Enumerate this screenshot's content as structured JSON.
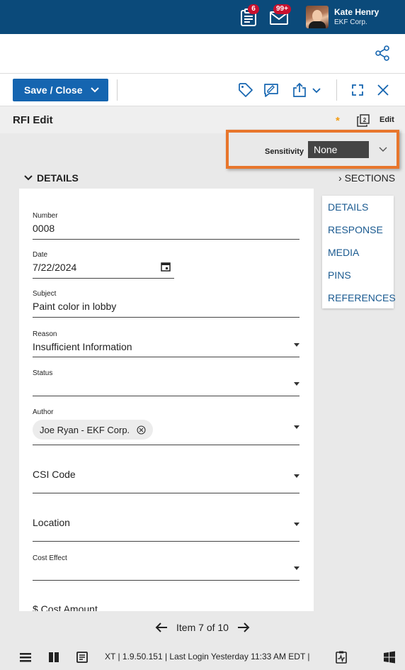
{
  "header": {
    "notifications_badge": "6",
    "messages_badge": "99+",
    "user_name": "Kate Henry",
    "user_org": "EKF Corp."
  },
  "toolbar": {
    "save_label": "Save / Close"
  },
  "title_bar": {
    "title": "RFI Edit",
    "modified_marker": "*",
    "edit_label": "Edit"
  },
  "sensitivity": {
    "label": "Sensitivity",
    "value": "None"
  },
  "details": {
    "header": "DETAILS",
    "sections_header": "SECTIONS"
  },
  "form": {
    "number": {
      "label": "Number",
      "value": "0008"
    },
    "date": {
      "label": "Date",
      "value": "7/22/2024"
    },
    "subject": {
      "label": "Subject",
      "value": "Paint color in lobby"
    },
    "reason": {
      "label": "Reason",
      "value": "Insufficient Information"
    },
    "status": {
      "label": "Status",
      "value": ""
    },
    "author": {
      "label": "Author",
      "value": "Joe Ryan - EKF Corp."
    },
    "csi_code": {
      "label": "CSI Code"
    },
    "location": {
      "label": "Location"
    },
    "cost_effect": {
      "label": "Cost Effect",
      "value": ""
    },
    "cost_amount": {
      "label": "$ Cost Amount"
    }
  },
  "sections_nav": [
    "DETAILS",
    "RESPONSE",
    "MEDIA",
    "PINS",
    "REFERENCES"
  ],
  "pager": {
    "text": "Item 7 of 10"
  },
  "status_bar": {
    "text": "XT  |  1.9.50.151  |  Last Login Yesterday 11:33 AM EDT  |"
  },
  "colors": {
    "topbar": "#0b4a7a",
    "primary": "#1565b0",
    "highlight": "#e8762c",
    "link": "#1a5a90"
  }
}
